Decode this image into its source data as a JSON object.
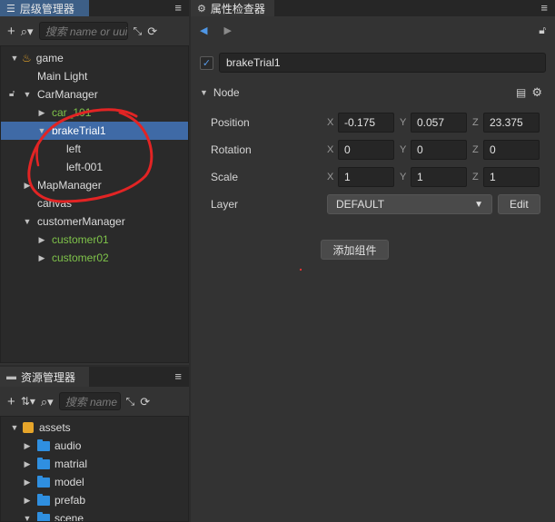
{
  "hierarchy": {
    "title": "层级管理器",
    "search_placeholder": "搜索 name or uuid",
    "nodes": [
      "game",
      "Main Light",
      "CarManager",
      "car_101",
      "brakeTrial1",
      "left",
      "left-001",
      "MapManager",
      "canvas",
      "customerManager",
      "customer01",
      "customer02"
    ]
  },
  "assets": {
    "title": "资源管理器",
    "search_placeholder": "搜索 name",
    "nodes": [
      "assets",
      "audio",
      "matrial",
      "model",
      "prefab",
      "scene"
    ]
  },
  "inspector": {
    "title": "属性检查器",
    "node_name": "brakeTrial1",
    "section": "Node",
    "props": {
      "position": {
        "label": "Position",
        "x": "-0.175",
        "y": "0.057",
        "z": "23.375"
      },
      "rotation": {
        "label": "Rotation",
        "x": "0",
        "y": "0",
        "z": "0"
      },
      "scale": {
        "label": "Scale",
        "x": "1",
        "y": "1",
        "z": "1"
      }
    },
    "layer": {
      "label": "Layer",
      "value": "DEFAULT",
      "edit_label": "Edit"
    },
    "add_component": "添加组件"
  },
  "axes": {
    "x": "X",
    "y": "Y",
    "z": "Z"
  },
  "colors": {
    "accent": "#3f6aa6",
    "selected_row": "#3f6aa6",
    "prefab_green": "#7fc34a",
    "folder_blue": "#2f8fe0",
    "annotation_red": "#e22424"
  }
}
